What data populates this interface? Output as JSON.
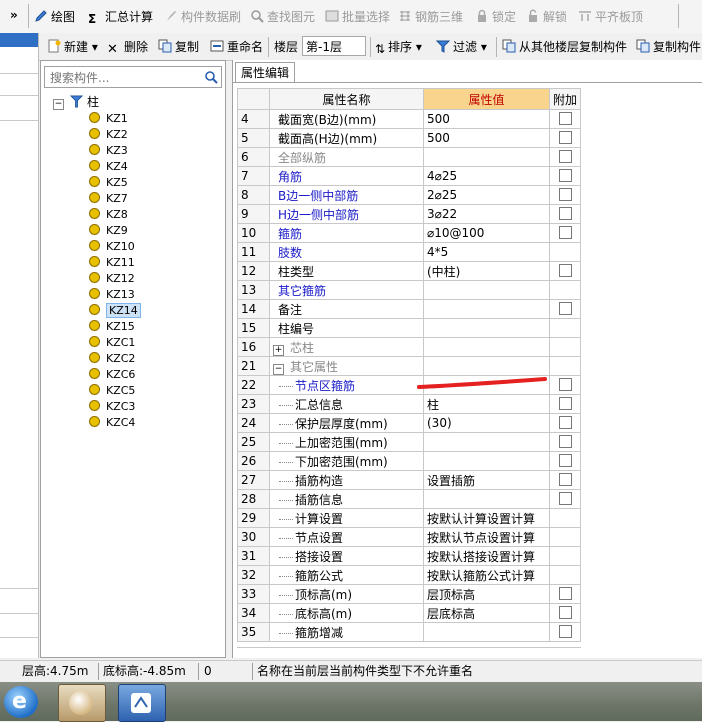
{
  "toolbar1": {
    "overflow": "»",
    "items": [
      {
        "label": "绘图",
        "disabled": false
      },
      {
        "label": "汇总计算",
        "disabled": false
      },
      {
        "label": "构件数据刷",
        "disabled": true
      },
      {
        "label": "查找图元",
        "disabled": true
      },
      {
        "label": "批量选择",
        "disabled": true
      },
      {
        "label": "钢筋三维",
        "disabled": true
      },
      {
        "label": "锁定",
        "disabled": true
      },
      {
        "label": "解锁",
        "disabled": true
      },
      {
        "label": "平齐板顶",
        "disabled": true
      }
    ]
  },
  "toolbar2": {
    "overflow": "»",
    "new_label": "新建",
    "delete_label": "删除",
    "copy_label": "复制",
    "rename_label": "重命名",
    "floor_label": "楼层",
    "floor_value": "第-1层",
    "sort_label": "排序",
    "filter_label": "过滤",
    "copy_from_floor_label": "从其他楼层复制构件",
    "copy_component_label": "复制构件"
  },
  "search": {
    "placeholder": "搜索构件..."
  },
  "tree": {
    "root_label": "柱",
    "items": [
      "KZ1",
      "KZ2",
      "KZ3",
      "KZ4",
      "KZ5",
      "KZ7",
      "KZ8",
      "KZ9",
      "KZ10",
      "KZ11",
      "KZ12",
      "KZ13",
      "KZ14",
      "KZ15",
      "KZC1",
      "KZC2",
      "KZC6",
      "KZC5",
      "KZC3",
      "KZC4"
    ],
    "selected": "KZ14"
  },
  "property_panel": {
    "tab_label": "属性编辑",
    "columns": {
      "name": "属性名称",
      "value": "属性值",
      "extra": "附加"
    },
    "rows": [
      {
        "num": "4",
        "name": "截面宽(B边)(mm)",
        "value": "500",
        "check": true,
        "style": "normal"
      },
      {
        "num": "5",
        "name": "截面高(H边)(mm)",
        "value": "500",
        "check": true,
        "style": "normal"
      },
      {
        "num": "6",
        "name": "全部纵筋",
        "value": "",
        "check": true,
        "style": "gray"
      },
      {
        "num": "7",
        "name": "角筋",
        "value": "4⌀25",
        "check": true,
        "style": "blue"
      },
      {
        "num": "8",
        "name": "B边一侧中部筋",
        "value": "2⌀25",
        "check": true,
        "style": "blue"
      },
      {
        "num": "9",
        "name": "H边一侧中部筋",
        "value": "3⌀22",
        "check": true,
        "style": "blue"
      },
      {
        "num": "10",
        "name": "箍筋",
        "value": "⌀10@100",
        "check": true,
        "style": "blue"
      },
      {
        "num": "11",
        "name": "肢数",
        "value": "4*5",
        "check": false,
        "style": "blue"
      },
      {
        "num": "12",
        "name": "柱类型",
        "value": "(中柱)",
        "check": true,
        "style": "normal"
      },
      {
        "num": "13",
        "name": "其它箍筋",
        "value": "",
        "check": false,
        "style": "blue"
      },
      {
        "num": "14",
        "name": "备注",
        "value": "",
        "check": true,
        "style": "normal"
      },
      {
        "num": "15",
        "name": "柱编号",
        "value": "",
        "check": false,
        "style": "normal"
      },
      {
        "num": "16",
        "name": "芯柱",
        "value": "",
        "check": false,
        "style": "group-collapsed"
      },
      {
        "num": "21",
        "name": "其它属性",
        "value": "",
        "check": false,
        "style": "group-expanded"
      },
      {
        "num": "22",
        "name": "节点区箍筋",
        "value": "",
        "check": true,
        "style": "child-blue"
      },
      {
        "num": "23",
        "name": "汇总信息",
        "value": "柱",
        "check": true,
        "style": "child"
      },
      {
        "num": "24",
        "name": "保护层厚度(mm)",
        "value": "(30)",
        "check": true,
        "style": "child"
      },
      {
        "num": "25",
        "name": "上加密范围(mm)",
        "value": "",
        "check": true,
        "style": "child"
      },
      {
        "num": "26",
        "name": "下加密范围(mm)",
        "value": "",
        "check": true,
        "style": "child"
      },
      {
        "num": "27",
        "name": "插筋构造",
        "value": "设置插筋",
        "check": true,
        "style": "child"
      },
      {
        "num": "28",
        "name": "插筋信息",
        "value": "",
        "check": true,
        "style": "child"
      },
      {
        "num": "29",
        "name": "计算设置",
        "value": "按默认计算设置计算",
        "check": false,
        "style": "child"
      },
      {
        "num": "30",
        "name": "节点设置",
        "value": "按默认节点设置计算",
        "check": false,
        "style": "child"
      },
      {
        "num": "31",
        "name": "搭接设置",
        "value": "按默认搭接设置计算",
        "check": false,
        "style": "child"
      },
      {
        "num": "32",
        "name": "箍筋公式",
        "value": "按默认箍筋公式计算",
        "check": false,
        "style": "child"
      },
      {
        "num": "33",
        "name": "顶标高(m)",
        "value": "层顶标高",
        "check": true,
        "style": "child"
      },
      {
        "num": "34",
        "name": "底标高(m)",
        "value": "层底标高",
        "check": true,
        "style": "child"
      },
      {
        "num": "35",
        "name": "箍筋增减",
        "value": "",
        "check": true,
        "style": "child"
      }
    ]
  },
  "status": {
    "floor_height": "层高:4.75m",
    "bottom_elevation": "底标高:-4.85m",
    "value": "0",
    "message": "名称在当前层当前构件类型下不允许重名"
  },
  "colors": {
    "value_header_bg": "#f8d48c",
    "value_header_text": "#c00000",
    "link_blue": "#1a1ac8",
    "annotation_red": "#e52020"
  }
}
